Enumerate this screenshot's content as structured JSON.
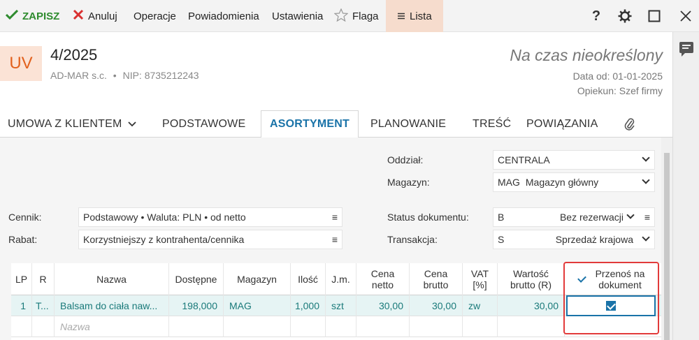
{
  "toolbar": {
    "save": "ZAPISZ",
    "cancel": "Anuluj",
    "operations": "Operacje",
    "notifications": "Powiadomienia",
    "settings": "Ustawienia",
    "flag": "Flaga",
    "list": "Lista",
    "help": "?"
  },
  "header": {
    "badge": "UV",
    "doc_no": "4/2025",
    "contractor": "AD-MAR s.c.",
    "nip": "NIP: 8735212243",
    "deadline": "Na czas nieokreślony",
    "date_from": "Data od: 01-01-2025",
    "guardian": "Opiekun: Szef firmy"
  },
  "tabs": [
    "UMOWA Z KLIENTEM",
    "PODSTAWOWE",
    "ASORTYMENT",
    "PLANOWANIE",
    "TREŚĆ",
    "POWIĄZANIA"
  ],
  "form": {
    "branch_label": "Oddział:",
    "branch_value": "CENTRALA",
    "warehouse_label": "Magazyn:",
    "warehouse_code": "MAG",
    "warehouse_name": "Magazyn główny",
    "pricelist_label": "Cennik:",
    "pricelist_value": "Podstawowy • Waluta: PLN • od netto",
    "discount_label": "Rabat:",
    "discount_value": "Korzystniejszy z kontrahenta/cennika",
    "status_label": "Status dokumentu:",
    "status_code": "B",
    "status_value": "Bez rezerwacji",
    "transaction_label": "Transakcja:",
    "transaction_code": "S",
    "transaction_value": "Sprzedaż krajowa"
  },
  "table": {
    "headers": {
      "lp": "LP",
      "r": "R",
      "name": "Nazwa",
      "available": "Dostępne",
      "warehouse": "Magazyn",
      "qty": "Ilość",
      "unit": "J.m.",
      "net_1": "Cena",
      "net_2": "netto",
      "gross_1": "Cena",
      "gross_2": "brutto",
      "vat_1": "VAT",
      "vat_2": "[%]",
      "value_1": "Wartość",
      "value_2": "brutto (R)",
      "transfer_1": "Przenoś na",
      "transfer_2": "dokument"
    },
    "row": {
      "lp": "1",
      "r": "T...",
      "name": "Balsam do ciała naw...",
      "available": "198,000",
      "warehouse": "MAG",
      "qty": "1,000",
      "unit": "szt",
      "net": "30,00",
      "gross": "30,00",
      "vat": "zw",
      "value": "30,00",
      "transfer": true
    },
    "new_row_placeholder": "Nazwa"
  }
}
